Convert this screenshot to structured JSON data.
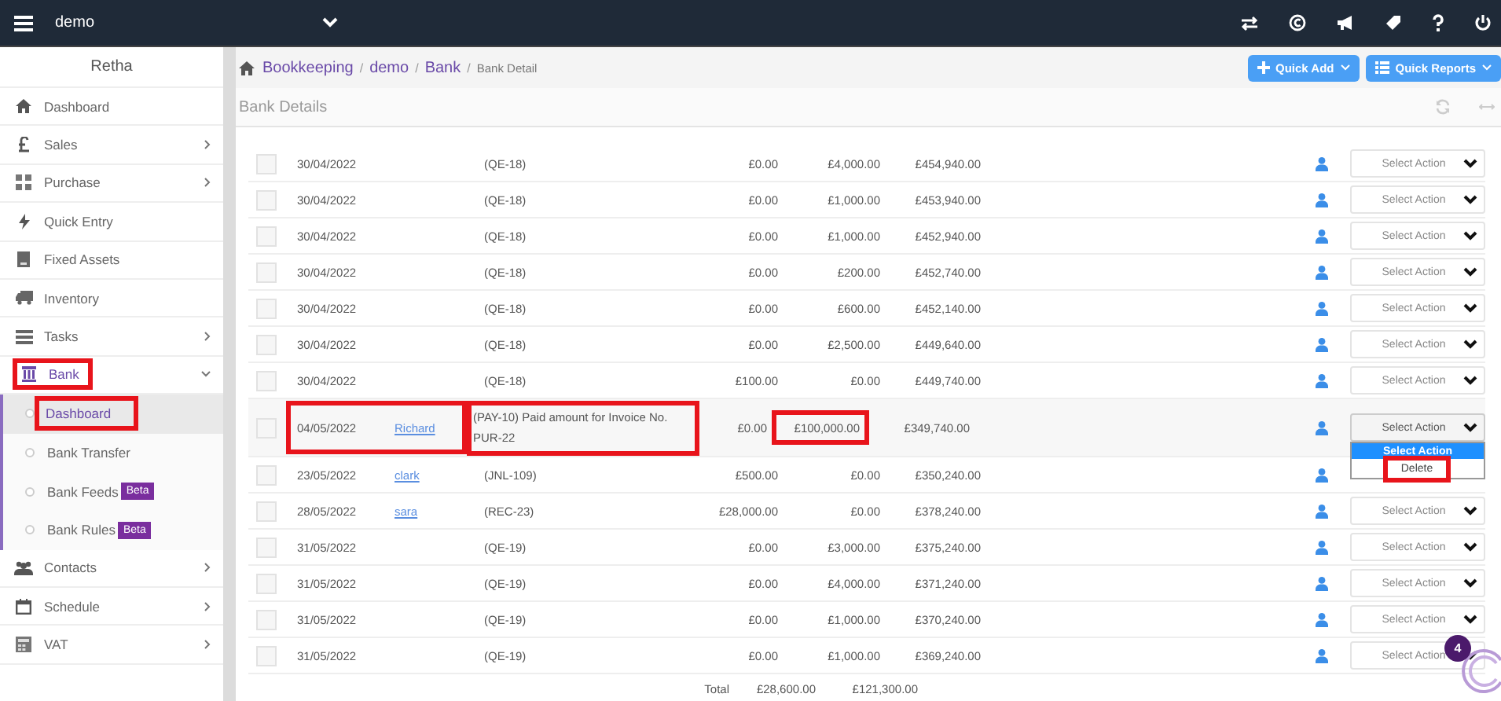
{
  "topbar": {
    "company": "demo"
  },
  "sidebar": {
    "user": "Retha",
    "items": [
      {
        "label": "Dashboard",
        "expandable": false,
        "highlighted": false
      },
      {
        "label": "Sales",
        "expandable": true,
        "expanded": false,
        "highlighted": false
      },
      {
        "label": "Purchase",
        "expandable": true,
        "expanded": false,
        "highlighted": false
      },
      {
        "label": "Quick Entry",
        "expandable": false,
        "highlighted": false
      },
      {
        "label": "Fixed Assets",
        "expandable": false,
        "highlighted": false
      },
      {
        "label": "Inventory",
        "expandable": false,
        "highlighted": false
      },
      {
        "label": "Tasks",
        "expandable": true,
        "expanded": false,
        "highlighted": false
      },
      {
        "label": "Bank",
        "expandable": true,
        "expanded": true,
        "highlighted": true,
        "children": [
          {
            "label": "Dashboard",
            "selected": true,
            "highlighted": true
          },
          {
            "label": "Bank Transfer",
            "selected": false,
            "highlighted": false
          },
          {
            "label": "Bank Feeds",
            "badge": "Beta",
            "selected": false,
            "highlighted": false
          },
          {
            "label": "Bank Rules",
            "badge": "Beta",
            "selected": false,
            "highlighted": false
          }
        ]
      },
      {
        "label": "Contacts",
        "expandable": true,
        "expanded": false,
        "highlighted": false
      },
      {
        "label": "Schedule",
        "expandable": true,
        "expanded": false,
        "highlighted": false
      },
      {
        "label": "VAT",
        "expandable": true,
        "expanded": false,
        "highlighted": false
      }
    ]
  },
  "breadcrumb": {
    "separator": "/",
    "items": [
      "Bookkeeping",
      "demo",
      "Bank",
      "Bank Detail"
    ]
  },
  "header_buttons": [
    "Quick Add",
    "Quick Reports"
  ],
  "panel": {
    "title": "Bank Details"
  },
  "rows": [
    {
      "checked": false,
      "highlighted": false,
      "date": "30/04/2022",
      "description": "(QE-18)",
      "received": "£0.00",
      "paid": "£4,000.00",
      "balance": "£454,940.00",
      "action": "Select Action"
    },
    {
      "checked": false,
      "highlighted": false,
      "date": "30/04/2022",
      "description": "(QE-18)",
      "received": "£0.00",
      "paid": "£1,000.00",
      "balance": "£453,940.00",
      "action": "Select Action"
    },
    {
      "checked": false,
      "highlighted": false,
      "date": "30/04/2022",
      "description": "(QE-18)",
      "received": "£0.00",
      "paid": "£1,000.00",
      "balance": "£452,940.00",
      "action": "Select Action"
    },
    {
      "checked": false,
      "highlighted": false,
      "date": "30/04/2022",
      "description": "(QE-18)",
      "received": "£0.00",
      "paid": "£200.00",
      "balance": "£452,740.00",
      "action": "Select Action"
    },
    {
      "checked": false,
      "highlighted": false,
      "date": "30/04/2022",
      "description": "(QE-18)",
      "received": "£0.00",
      "paid": "£600.00",
      "balance": "£452,140.00",
      "action": "Select Action"
    },
    {
      "checked": false,
      "highlighted": false,
      "date": "30/04/2022",
      "description": "(QE-18)",
      "received": "£0.00",
      "paid": "£2,500.00",
      "balance": "£449,640.00",
      "action": "Select Action"
    },
    {
      "checked": false,
      "highlighted": false,
      "date": "30/04/2022",
      "description": "(QE-18)",
      "received": "£100.00",
      "paid": "£0.00",
      "balance": "£449,740.00",
      "action": "Select Action"
    },
    {
      "checked": false,
      "highlighted": true,
      "date": "04/05/2022",
      "name": "Richard",
      "description": "(PAY-10) Paid amount for Invoice No. PUR-22",
      "received": "£0.00",
      "paid": "£100,000.00",
      "balance": "£349,740.00",
      "action": "Select Action",
      "action_menu": [
        {
          "label": "Select Action",
          "selected": true,
          "highlighted": false
        },
        {
          "label": "Delete",
          "selected": false,
          "highlighted": true
        }
      ]
    },
    {
      "checked": false,
      "highlighted": false,
      "date": "23/05/2022",
      "name": "clark",
      "description": "(JNL-109)",
      "received": "£500.00",
      "paid": "£0.00",
      "balance": "£350,240.00"
    },
    {
      "checked": false,
      "highlighted": false,
      "date": "28/05/2022",
      "name": "sara",
      "description": "(REC-23)",
      "received": "£28,000.00",
      "paid": "£0.00",
      "balance": "£378,240.00",
      "action": "Select Action"
    },
    {
      "checked": false,
      "highlighted": false,
      "date": "31/05/2022",
      "description": "(QE-19)",
      "received": "£0.00",
      "paid": "£3,000.00",
      "balance": "£375,240.00",
      "action": "Select Action"
    },
    {
      "checked": false,
      "highlighted": false,
      "date": "31/05/2022",
      "description": "(QE-19)",
      "received": "£0.00",
      "paid": "£4,000.00",
      "balance": "£371,240.00",
      "action": "Select Action"
    },
    {
      "checked": false,
      "highlighted": false,
      "date": "31/05/2022",
      "description": "(QE-19)",
      "received": "£0.00",
      "paid": "£1,000.00",
      "balance": "£370,240.00",
      "action": "Select Action"
    },
    {
      "checked": false,
      "highlighted": false,
      "date": "31/05/2022",
      "description": "(QE-19)",
      "received": "£0.00",
      "paid": "£1,000.00",
      "balance": "£369,240.00",
      "action": "Select Action"
    }
  ],
  "totals": {
    "label": "Total",
    "received": "£28,600.00",
    "paid": "£121,300.00"
  },
  "chat": {
    "badge": "4"
  }
}
